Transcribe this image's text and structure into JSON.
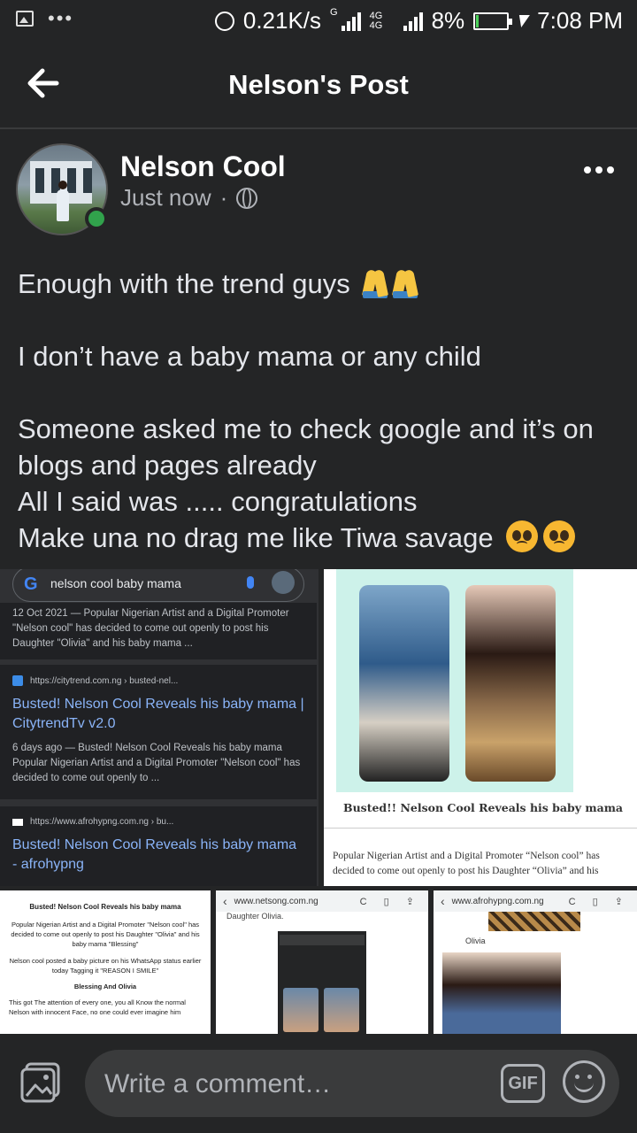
{
  "status_bar": {
    "speed": "0.21K/s",
    "sim1": "G",
    "network": "4G 4G",
    "battery_pct": "8%",
    "battery_level": 0.08,
    "time": "7:08 PM"
  },
  "header": {
    "title": "Nelson's Post"
  },
  "post": {
    "author": "Nelson Cool",
    "timestamp": "Just now",
    "separator": "·",
    "lines": [
      "Enough with the trend guys",
      "I don’t have a baby mama or any child",
      "Someone asked me to check google  and it’s on blogs and pages already",
      "All I said was ..... congratulations",
      "Make una no drag me like Tiwa savage"
    ]
  },
  "screenshot1": {
    "query": "nelson cool baby mama",
    "result_a_snippet": "12 Oct 2021 — Popular Nigerian Artist and a Digital Promoter \"Nelson cool\" has decided to come out openly to post his Daughter \"Olivia\" and his baby mama ...",
    "result_b_url": "https://citytrend.com.ng › busted-nel...",
    "result_b_title": "Busted! Nelson Cool Reveals his baby mama | CitytrendTv v2.0",
    "result_b_snippet": "6 days ago — Busted! Nelson Cool Reveals his baby mama Popular Nigerian Artist and a Digital Promoter \"Nelson cool\" has decided to come out openly to ...",
    "result_c_url": "https://www.afrohypng.com.ng › bu...",
    "result_c_title": "Busted! Nelson Cool Reveals his baby mama - afrohypng"
  },
  "screenshot2": {
    "caption": "Busted!! Nelson Cool Reveals his baby mama",
    "article": "Popular Nigerian Artist and a Digital Promoter “Nelson cool” has decided to come out openly to post his Daughter “Olivia” and his"
  },
  "screenshot3": {
    "heading": "Busted! Nelson Cool Reveals his baby mama",
    "p1": "Popular Nigerian Artist and a Digital Promoter \"Nelson cool\" has decided to come out openly to post his Daughter \"Olivia\" and his baby mama \"Blessing\"",
    "p2": "Nelson cool posted a baby picture on his WhatsApp status earlier today Tagging it \"REASON I SMILE\"",
    "heading2": "Blessing And Olivia",
    "p3": "This got The attention of every one, you all Know the normal Nelson with innocent Face, no one could ever imagine him"
  },
  "screenshot4": {
    "url": "www.netsong.com.ng",
    "subtext": "Daughter Olivia."
  },
  "screenshot5": {
    "url": "www.afrohypng.com.ng",
    "label": "Olivia"
  },
  "composer": {
    "placeholder": "Write a comment…",
    "gif_label": "GIF"
  }
}
